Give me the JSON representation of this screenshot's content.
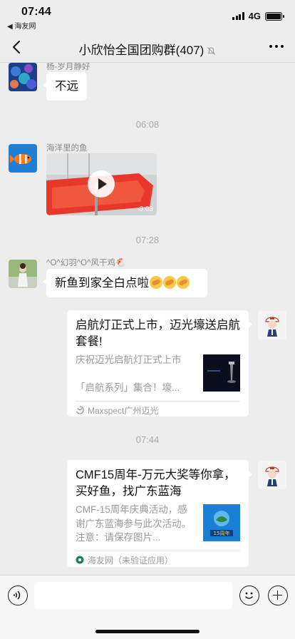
{
  "status_bar": {
    "time": "07:44",
    "back_app": "◀ 海友网",
    "network": "4G"
  },
  "nav": {
    "title": "小欣怡全国团购群(407)"
  },
  "messages": {
    "m1": {
      "sender": "杨-岁月静好",
      "text": "不远"
    },
    "ts1": "06:08",
    "m2": {
      "sender": "海洋里的鱼",
      "duration": "0:03"
    },
    "ts2": "07:28",
    "m3": {
      "sender": "^O^幻羽^O^风干鸡🐔",
      "text": "新鱼到家全白点啦"
    },
    "card1": {
      "title": "启航灯正式上市，迈光壕送启航套餐!",
      "desc": "庆祝迈光启航灯正式上市\n\n「启航系列」集合！壕...",
      "source": "Maxspect广州迈光"
    },
    "ts3": "07:44",
    "card2": {
      "title": "CMF15周年-万元大奖等你拿，买好鱼，找广东蓝海",
      "desc": "CMF-15周年庆典活动，感谢广东蓝海参与此次活动。注意：请保存图片...",
      "source": "海友网（未验证应用）"
    }
  },
  "colors": {
    "background": "#ededed",
    "bubble": "#ffffff",
    "video_red": "#e8372b"
  }
}
